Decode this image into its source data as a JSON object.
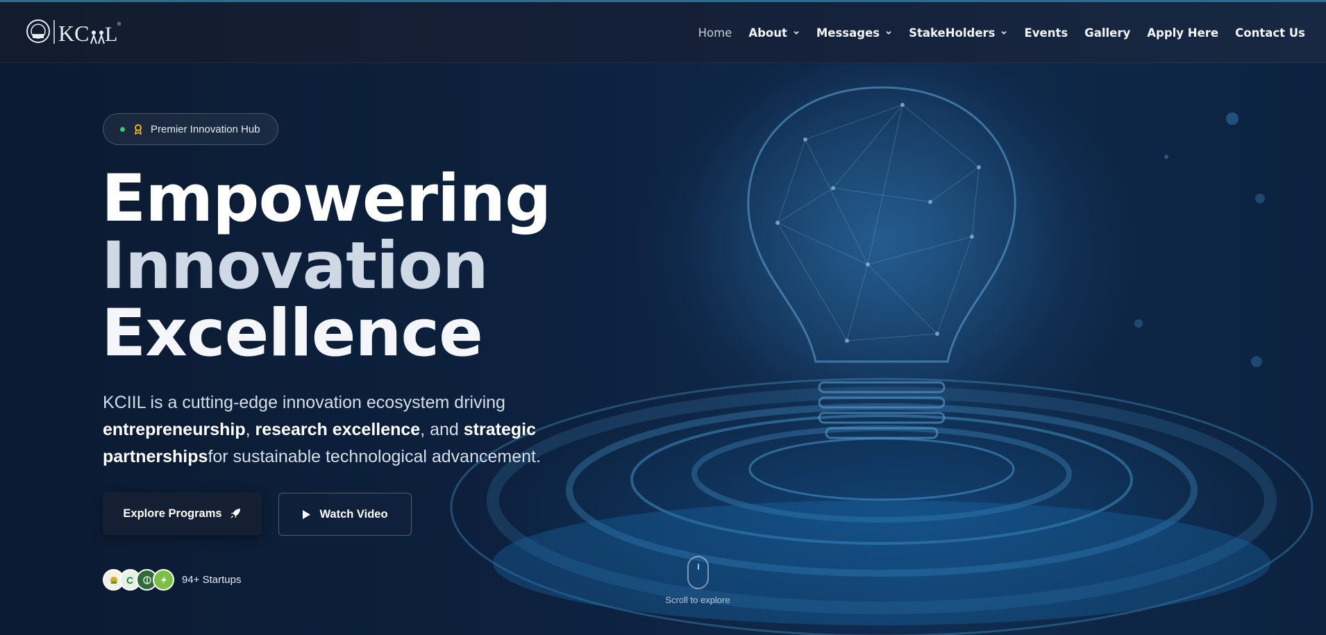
{
  "brand": {
    "logo_text": "KCiiL"
  },
  "nav": {
    "items": [
      {
        "label": "Home",
        "active": true,
        "dropdown": false
      },
      {
        "label": "About",
        "active": false,
        "dropdown": true
      },
      {
        "label": "Messages",
        "active": false,
        "dropdown": true
      },
      {
        "label": "StakeHolders",
        "active": false,
        "dropdown": true
      },
      {
        "label": "Events",
        "active": false,
        "dropdown": false
      },
      {
        "label": "Gallery",
        "active": false,
        "dropdown": false
      },
      {
        "label": "Apply Here",
        "active": false,
        "dropdown": false
      },
      {
        "label": "Contact Us",
        "active": false,
        "dropdown": false
      }
    ]
  },
  "hero": {
    "badge": "Premier Innovation Hub",
    "headline": {
      "line1": "Empowering",
      "line2": "Innovation",
      "line3": "Excellence"
    },
    "description": {
      "part1": "KCIIL is a cutting-edge innovation ecosystem driving ",
      "bold1": "entrepreneurship",
      "sep1": ", ",
      "bold2": "research excellence",
      "sep2": ", and ",
      "bold3": "strategic partnerships",
      "part2": "for sustainable technological advancement."
    },
    "primary_button": "Explore Programs",
    "secondary_button": "Watch Video",
    "startups_count": "94+ Startups",
    "scroll_hint": "Scroll to explore"
  },
  "colors": {
    "background": "#0c1d34",
    "navbar": "#121c2e",
    "accent_line": "#2e6d8f",
    "status_dot": "#3ec86a",
    "award_icon": "#f2b01e"
  }
}
